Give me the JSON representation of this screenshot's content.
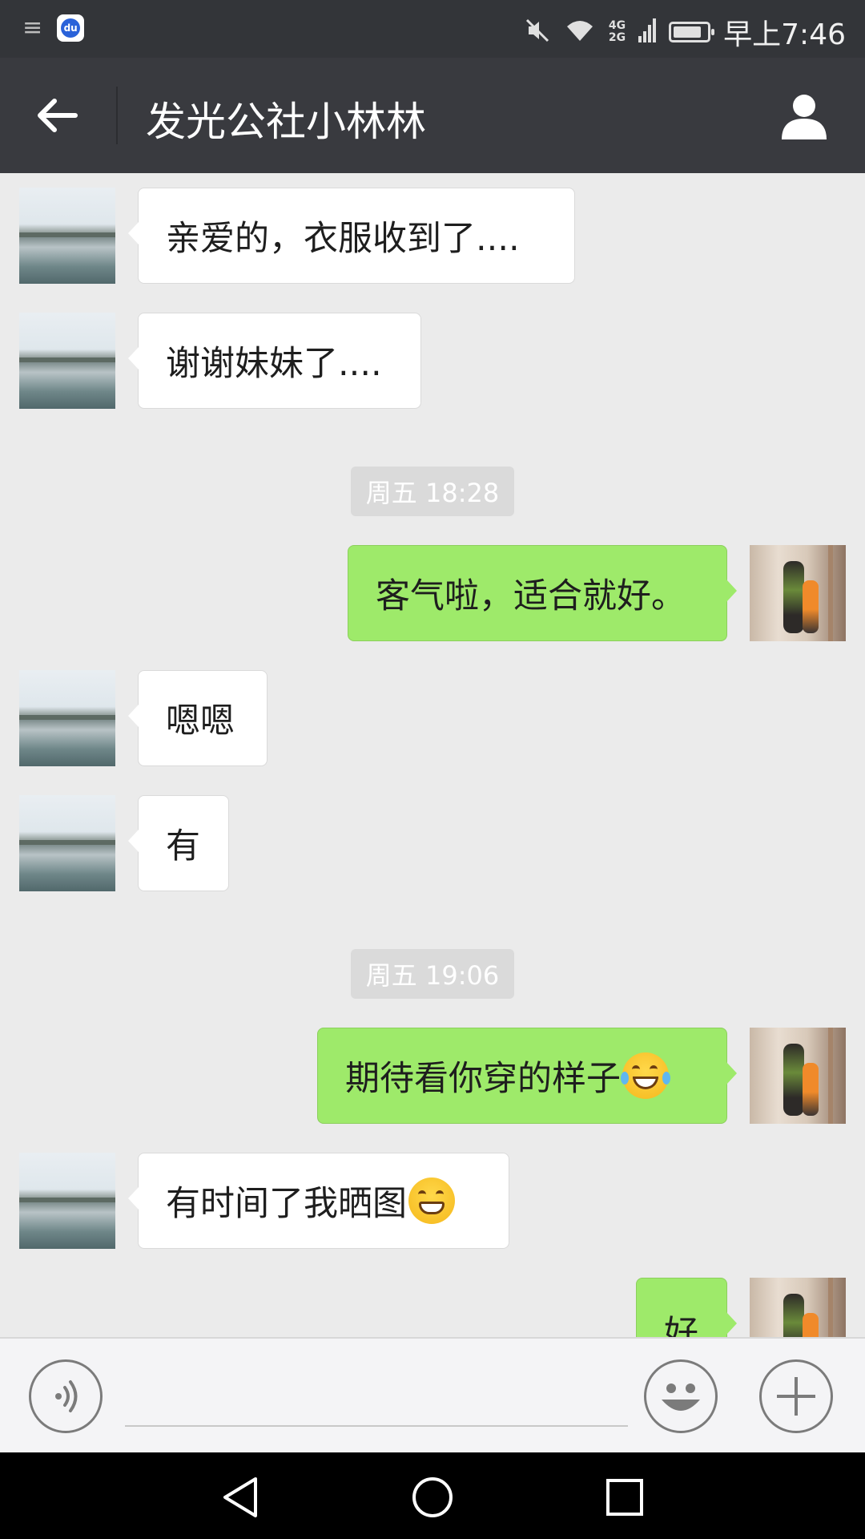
{
  "status_bar": {
    "time": "早上7:46",
    "network_top": "4G",
    "network_bottom": "2G",
    "battery_level": 0.85,
    "icons": [
      "menu-icon",
      "baidu-app-icon",
      "mute-icon",
      "wifi-icon",
      "signal-icon",
      "battery-icon"
    ]
  },
  "header": {
    "title": "发光公社小林林",
    "left_icon": "back-arrow-icon",
    "right_icon": "profile-icon"
  },
  "messages": [
    {
      "side": "left",
      "text": "亲爱的，衣服收到了...."
    },
    {
      "side": "left",
      "text": "谢谢妹妹了...."
    },
    {
      "type": "time",
      "text": "周五 18:28"
    },
    {
      "side": "right",
      "text": "客气啦，适合就好。"
    },
    {
      "side": "left",
      "text": "嗯嗯"
    },
    {
      "side": "left",
      "text": "有"
    },
    {
      "type": "time",
      "text": "周五 19:06"
    },
    {
      "side": "right",
      "text": "期待看你穿的样子",
      "emoji": "tears-of-joy-emoji"
    },
    {
      "side": "left",
      "text": "有时间了我晒图",
      "emoji": "grinning-emoji"
    },
    {
      "side": "right",
      "text": "好"
    }
  ],
  "input_bar": {
    "value": "",
    "icons": [
      "voice-icon",
      "emoji-icon",
      "plus-icon"
    ]
  },
  "nav_bar": {
    "icons": [
      "back-triangle-icon",
      "home-circle-icon",
      "recents-square-icon"
    ]
  },
  "colors": {
    "header_bg": "#393a3f",
    "status_bg": "#333539",
    "chat_bg": "#ebebeb",
    "sent_bubble": "#9eea6a",
    "received_bubble": "#ffffff"
  }
}
